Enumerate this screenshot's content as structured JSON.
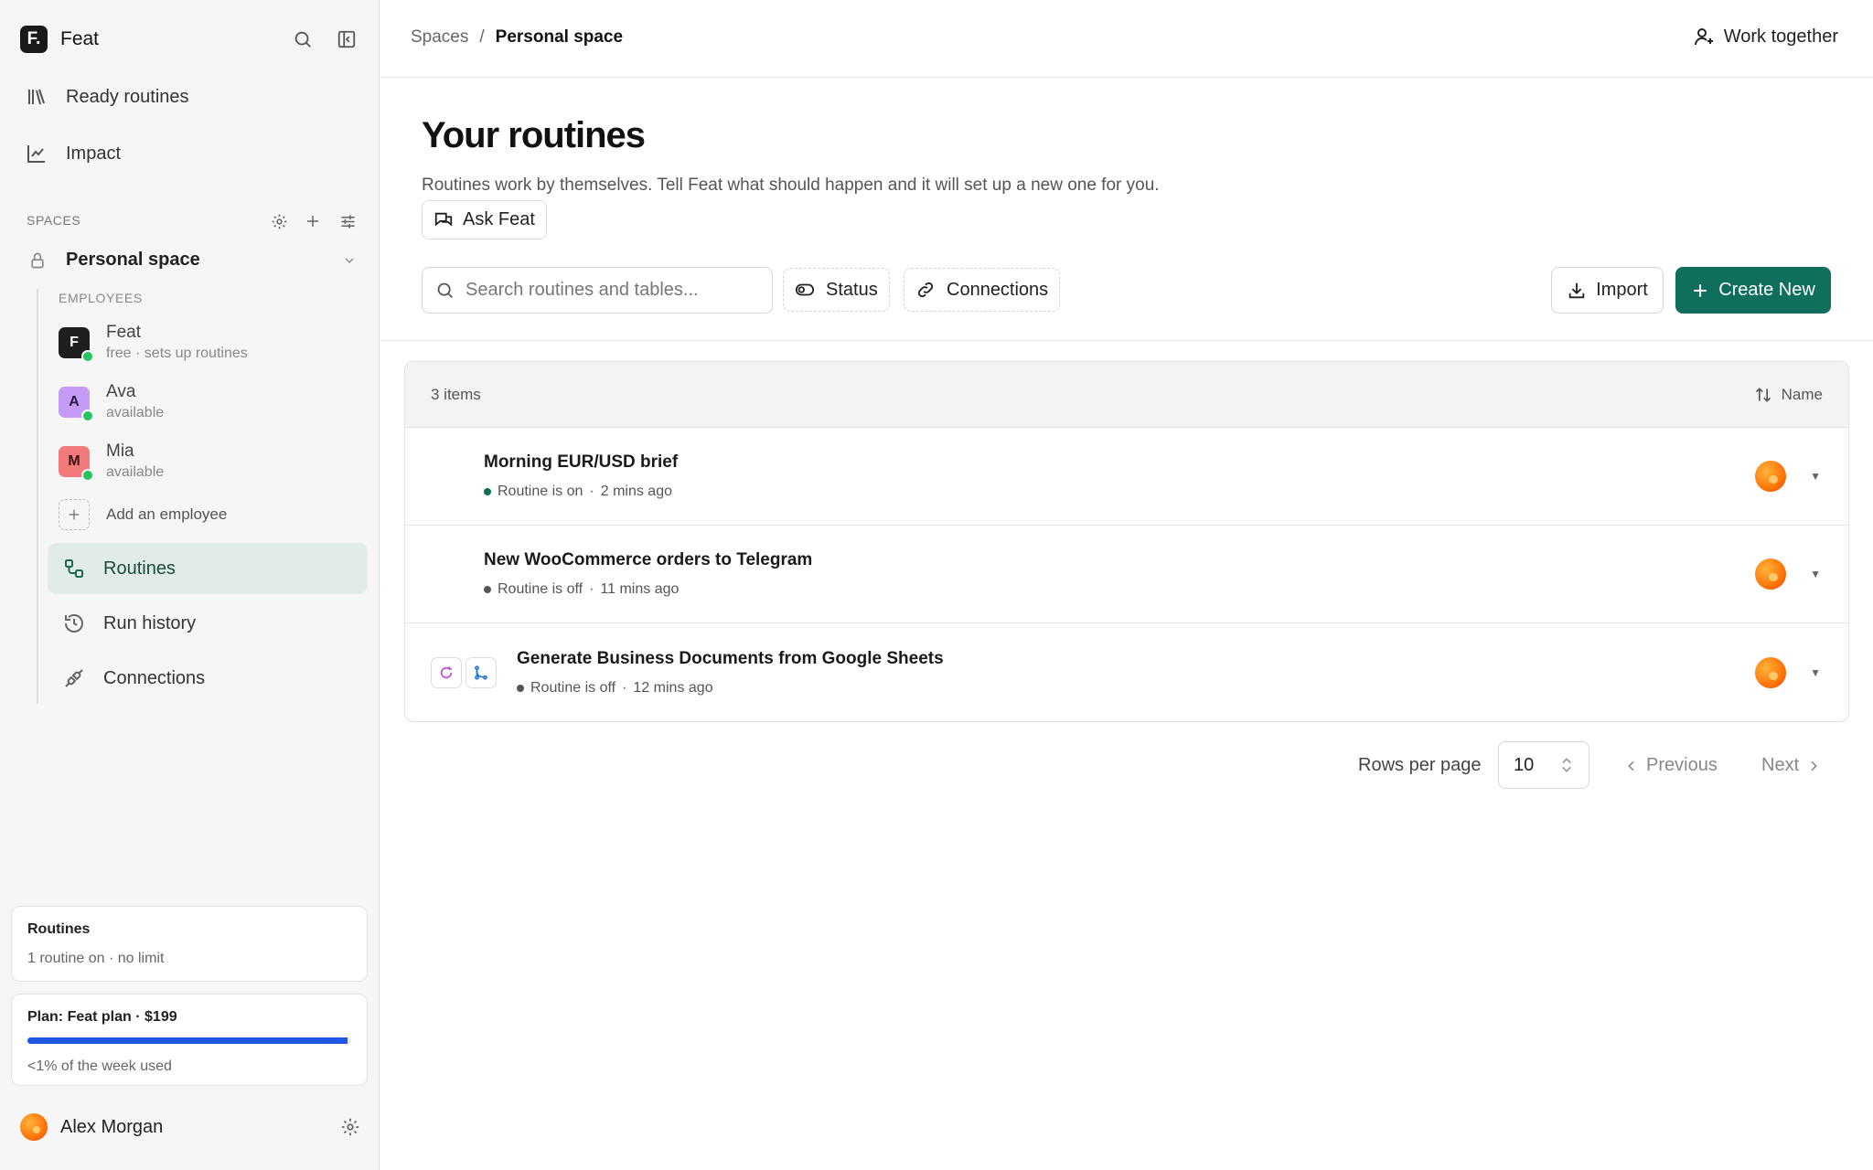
{
  "brand": {
    "logo": "F.",
    "name": "Feat"
  },
  "sidebar": {
    "nav": [
      {
        "label": "Ready routines",
        "icon": "library-icon"
      },
      {
        "label": "Impact",
        "icon": "chart-line-icon"
      }
    ],
    "spaces_label": "SPACES",
    "space": {
      "name": "Personal space"
    },
    "employees_label": "EMPLOYEES",
    "employees": [
      {
        "initial": "F",
        "name": "Feat",
        "sub": "free · sets up routines",
        "color": "#1f1f1f"
      },
      {
        "initial": "A",
        "name": "Ava",
        "sub": "available",
        "color": "#c59cf5"
      },
      {
        "initial": "M",
        "name": "Mia",
        "sub": "available",
        "color": "#f27a7a"
      }
    ],
    "add_employee": "Add an employee",
    "sub_nav": [
      {
        "label": "Routines",
        "icon": "routines-icon",
        "active": true
      },
      {
        "label": "Run history",
        "icon": "history-icon",
        "active": false
      },
      {
        "label": "Connections",
        "icon": "plug-icon",
        "active": false
      }
    ],
    "usage_card": {
      "title": "Routines",
      "sub": "1 routine on · no limit"
    },
    "plan_card": {
      "title": "Plan: Feat plan · $199",
      "sub": "<1% of the week used",
      "progress": 0.99
    },
    "user": {
      "name": "Alex Morgan"
    }
  },
  "header": {
    "breadcrumb": {
      "root": "Spaces",
      "sep": "/",
      "current": "Personal space"
    },
    "work_together": "Work together"
  },
  "main": {
    "title": "Your routines",
    "description": "Routines work by themselves. Tell Feat what should happen and it will set up a new one for you.",
    "ask_button": "Ask Feat",
    "search_placeholder": "Search routines and tables...",
    "filters": {
      "status": "Status",
      "connections": "Connections"
    },
    "import_button": "Import",
    "create_button": "Create New",
    "accent": "#0f6e5c"
  },
  "table": {
    "count": "3 items",
    "sort_label": "Name",
    "rows": [
      {
        "title": "Morning EUR/USD brief",
        "status": "Routine is on",
        "time": "2 mins ago",
        "on": true
      },
      {
        "title": "New WooCommerce orders to Telegram",
        "status": "Routine is off",
        "time": "11 mins ago",
        "on": false
      },
      {
        "title": "Generate Business Documents from Google Sheets",
        "status": "Routine is off",
        "time": "12 mins ago",
        "on": false
      }
    ]
  },
  "pagination": {
    "rows_label": "Rows per page",
    "rows_value": "10",
    "previous": "Previous",
    "next": "Next"
  }
}
